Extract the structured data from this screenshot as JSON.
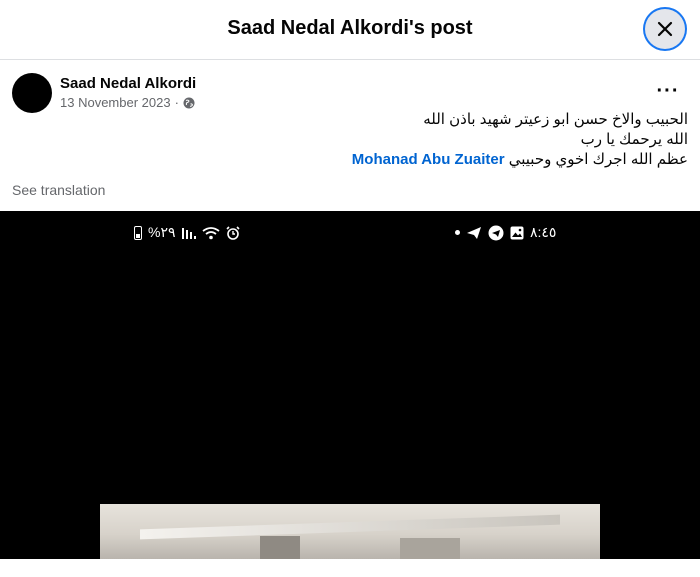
{
  "dialog": {
    "title": "Saad Nedal Alkordi's post",
    "close_icon": "close-icon"
  },
  "post": {
    "author": "Saad Nedal Alkordi",
    "date": "13 November 2023",
    "date_separator": "·",
    "privacy_icon": "globe-icon",
    "more_label": "···",
    "text_lines": [
      "الحبيب والاخ حسن ابو زعيتر شهيد باذن الله",
      "الله يرحمك يا رب",
      "عظم الله اجرك اخوي وحبيبي"
    ],
    "mention": "Mohanad Abu Zuaiter",
    "see_translation": "See translation"
  },
  "media": {
    "status_left": "%٢٩",
    "status_right": "٨:٤٥"
  },
  "colors": {
    "link": "#0064d1",
    "focus_ring": "#1877f2",
    "secondary_text": "#65676b"
  }
}
